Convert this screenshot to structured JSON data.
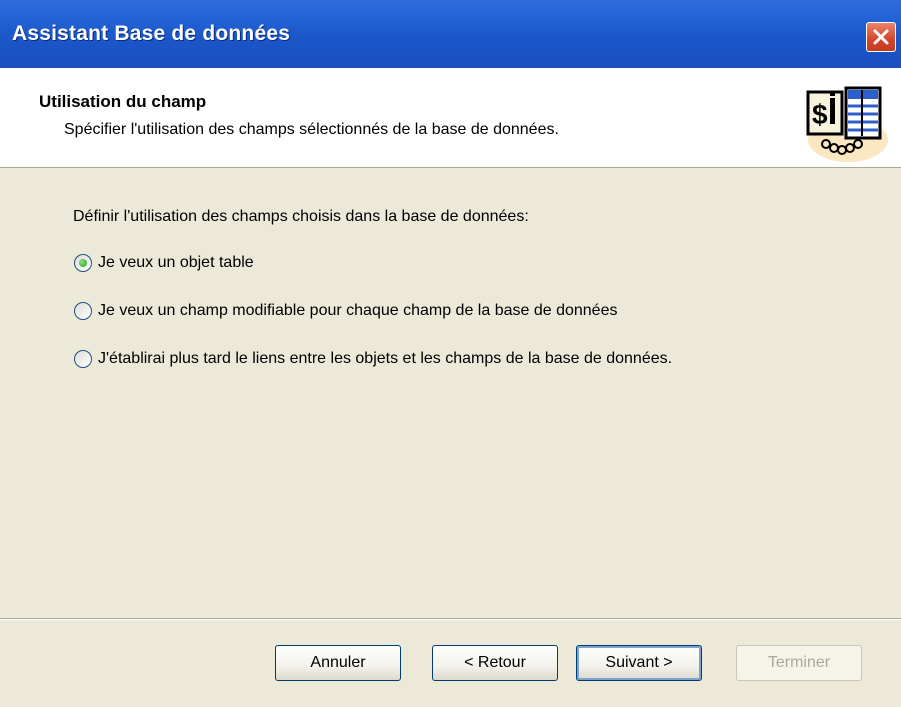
{
  "window": {
    "title": "Assistant Base de données"
  },
  "header": {
    "title": "Utilisation du champ",
    "subtitle": "Spécifier l'utilisation des champs sélectionnés de la base de données."
  },
  "main": {
    "question": "Définir l'utilisation des champs choisis dans la base de données:",
    "options": [
      {
        "label": "Je veux un objet table",
        "checked": true
      },
      {
        "label": "Je veux un champ modifiable pour chaque champ de la base de données",
        "checked": false
      },
      {
        "label": "J'établirai plus tard le liens entre les objets et les champs de la base de données.",
        "checked": false
      }
    ]
  },
  "buttons": {
    "cancel": "Annuler",
    "back": "< Retour",
    "next": "Suivant >",
    "finish": "Terminer"
  },
  "colors": {
    "titlebar": "#1a56c8",
    "dialog_bg": "#ece9d8",
    "close": "#d5452a"
  }
}
